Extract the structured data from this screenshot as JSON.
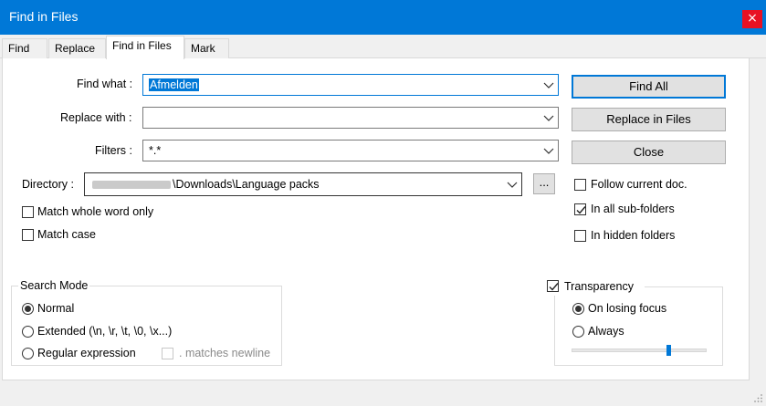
{
  "window": {
    "title": "Find in Files",
    "close_glyph": "×"
  },
  "tabs": [
    {
      "label": "Find",
      "active": false
    },
    {
      "label": "Replace",
      "active": false
    },
    {
      "label": "Find in Files",
      "active": true
    },
    {
      "label": "Mark",
      "active": false
    }
  ],
  "fields": {
    "find_what": {
      "label": "Find what :",
      "value": "Afmelden"
    },
    "replace_with": {
      "label": "Replace with :",
      "value": ""
    },
    "filters": {
      "label": "Filters :",
      "value": "*.*"
    },
    "directory": {
      "label": "Directory :",
      "value": "\\Downloads\\Language packs",
      "browse_label": "..."
    }
  },
  "buttons": {
    "find_all": "Find All",
    "replace_in_files": "Replace in Files",
    "close": "Close"
  },
  "options": {
    "match_whole_word": {
      "label": "Match whole word only",
      "checked": false
    },
    "match_case": {
      "label": "Match case",
      "checked": false
    },
    "follow_current_doc": {
      "label": "Follow current doc.",
      "checked": false
    },
    "in_all_subfolders": {
      "label": "In all sub-folders",
      "checked": true
    },
    "in_hidden_folders": {
      "label": "In hidden folders",
      "checked": false
    }
  },
  "search_mode": {
    "title": "Search Mode",
    "normal": {
      "label": "Normal",
      "selected": true
    },
    "extended": {
      "label": "Extended (\\n, \\r, \\t, \\0, \\x...)",
      "selected": false
    },
    "regex": {
      "label": "Regular expression",
      "selected": false
    },
    "matches_newline": {
      "label": ". matches newline",
      "checked": false,
      "enabled": false
    }
  },
  "transparency": {
    "title": "Transparency",
    "checked": true,
    "on_losing_focus": {
      "label": "On losing focus",
      "selected": true
    },
    "always": {
      "label": "Always",
      "selected": false
    },
    "slider_level": 0.72
  },
  "colors": {
    "accent": "#0078d7",
    "titlebar": "#0078d7",
    "close": "#e81123"
  }
}
